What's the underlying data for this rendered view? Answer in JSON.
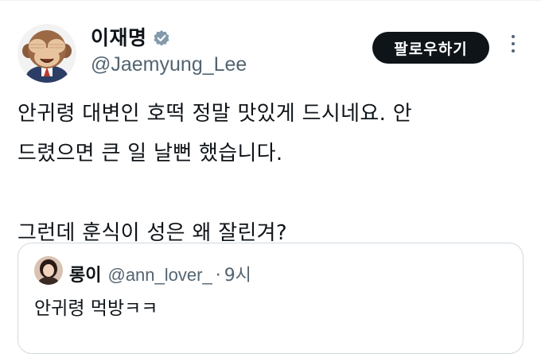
{
  "tweet": {
    "display_name": "이재명",
    "handle": "@Jaemyung_Lee",
    "verified": true,
    "follow_label": "팔로우하기",
    "text": "안귀령 대변인 호떡 정말 맛있게 드시네요. 안\n드렸으면 큰 일 날뻔 했습니다.\n\n그런데 훈식이 성은 왜 잘린겨?",
    "avatar_icon": "see-no-evil-monkey-avatar",
    "more_icon": "more-vertical-icon",
    "colors": {
      "follow_bg": "#0f1419",
      "muted": "#536471",
      "border": "#cfd9de"
    }
  },
  "quote": {
    "display_name": "롱이",
    "handle": "@ann_lover_",
    "separator": "·",
    "time": "9시",
    "text": "안귀령 먹방ㅋㅋ"
  }
}
